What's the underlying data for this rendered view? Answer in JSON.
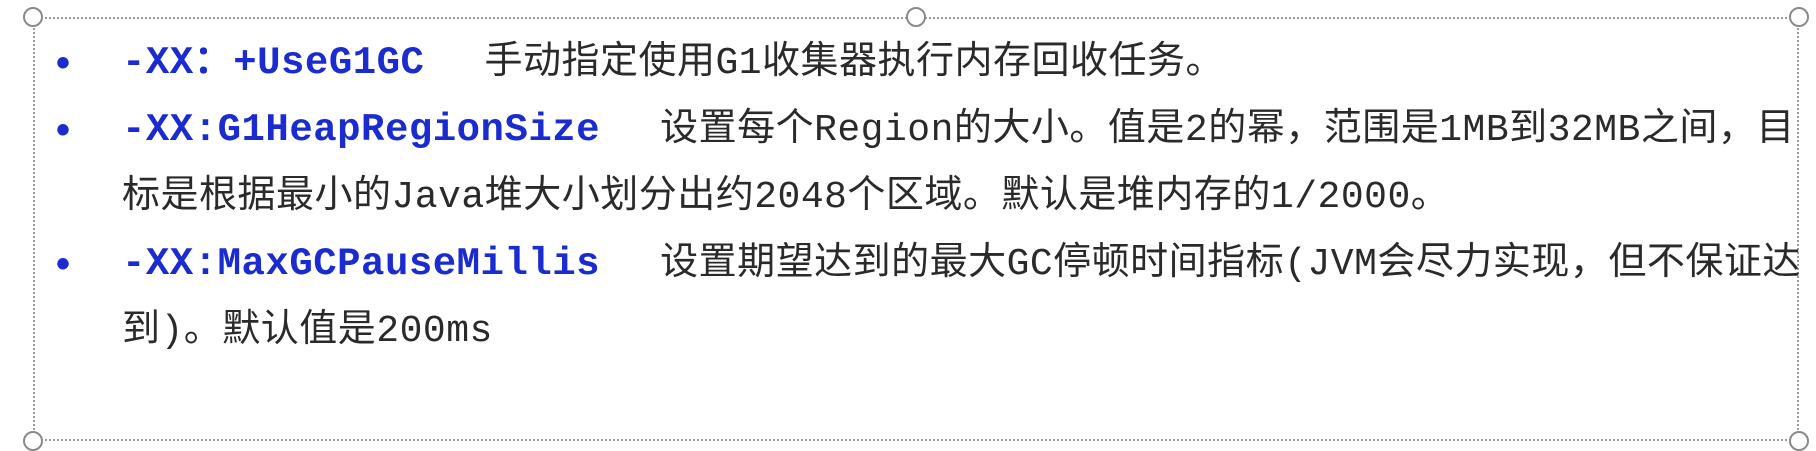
{
  "items": [
    {
      "param": "-XX：+UseG1GC",
      "desc": "手动指定使用G1收集器执行内存回收任务。"
    },
    {
      "param": "-XX:G1HeapRegionSize",
      "desc": "设置每个Region的大小。值是2的幂，范围是1MB到32MB之间，目标是根据最小的Java堆大小划分出约2048个区域。默认是堆内存的1/2000。"
    },
    {
      "param": "-XX:MaxGCPauseMillis",
      "desc": "设置期望达到的最大GC停顿时间指标(JVM会尽力实现，但不保证达到)。默认值是200ms"
    }
  ]
}
